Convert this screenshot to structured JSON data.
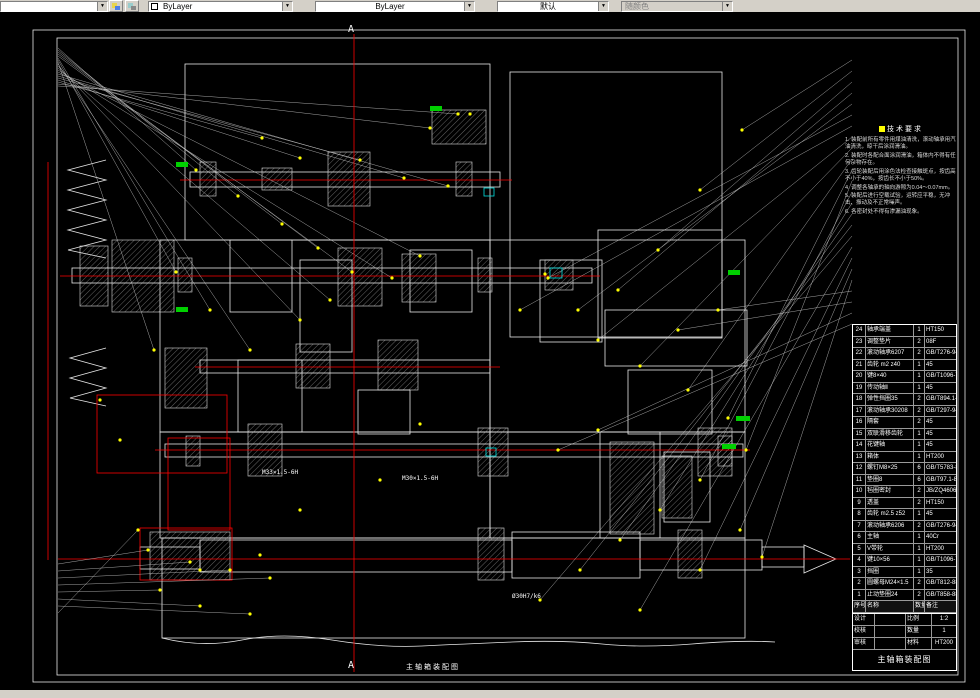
{
  "toolbar": {
    "layer_combo": {
      "value": ""
    },
    "color_control": {
      "value": "ByLayer"
    },
    "linetype_control": {
      "value": "ByLayer"
    },
    "lineweight_control": {
      "value": "默认"
    },
    "plotstyle_control": {
      "value": "随颜色"
    }
  },
  "colors": {
    "canvas_bg": "#000000",
    "line": "#ffffff",
    "centerline": "#ff0000",
    "leader_dot": "#ffff00",
    "highlight": "#00ff00"
  },
  "drawing": {
    "section_label_top": "A",
    "section_label_bottom": "A",
    "dim_labels": [
      "M33×1.5-6H",
      "M30×1.5-6H",
      "Ø30H7/k6"
    ],
    "bottom_label": "主轴箱装配图",
    "tech_requirements": {
      "title": "技术要求",
      "lines": [
        "1. 装配前所有零件用煤油清洗，滚动轴承用汽油清洗，晾干后涂润滑油。",
        "2. 装配时各配合面涂润滑油，箱体内不得有任何杂物存在。",
        "3. 齿轮装配后用涂色法检查接触斑点，按齿高不小于40%，按齿长不小于50%。",
        "4. 调整各轴承的轴向游隙为0.04～0.07mm。",
        "5. 装配后进行空载试验，运转应平稳，无冲击、振动及不正常噪声。",
        "6. 各密封处不得有渗漏油现象。"
      ]
    },
    "parts_table": {
      "header": [
        "序号",
        "名称",
        "数量",
        "备注"
      ],
      "rows": [
        {
          "no": "24",
          "name": "轴承端盖",
          "qty": "1",
          "note": "HT150"
        },
        {
          "no": "23",
          "name": "调整垫片",
          "qty": "2",
          "note": "08F"
        },
        {
          "no": "22",
          "name": "滚动轴承6207",
          "qty": "2",
          "note": "GB/T276-94"
        },
        {
          "no": "21",
          "name": "齿轮 m2 z40",
          "qty": "1",
          "note": "45"
        },
        {
          "no": "20",
          "name": "键8×40",
          "qty": "1",
          "note": "GB/T1096-79"
        },
        {
          "no": "19",
          "name": "传动轴Ⅱ",
          "qty": "1",
          "note": "45"
        },
        {
          "no": "18",
          "name": "弹性挡圈35",
          "qty": "2",
          "note": "GB/T894.1-86"
        },
        {
          "no": "17",
          "name": "滚动轴承30208",
          "qty": "2",
          "note": "GB/T297-94"
        },
        {
          "no": "16",
          "name": "隔套",
          "qty": "2",
          "note": "45"
        },
        {
          "no": "15",
          "name": "双联滑移齿轮",
          "qty": "1",
          "note": "45"
        },
        {
          "no": "14",
          "name": "花键轴",
          "qty": "1",
          "note": "45"
        },
        {
          "no": "13",
          "name": "箱体",
          "qty": "1",
          "note": "HT200"
        },
        {
          "no": "12",
          "name": "螺钉M8×25",
          "qty": "6",
          "note": "GB/T5783-86"
        },
        {
          "no": "11",
          "name": "垫圈8",
          "qty": "6",
          "note": "GB/T97.1-85"
        },
        {
          "no": "10",
          "name": "毡圈密封",
          "qty": "2",
          "note": "JB/ZQ4606"
        },
        {
          "no": "9",
          "name": "透盖",
          "qty": "2",
          "note": "HT150"
        },
        {
          "no": "8",
          "name": "齿轮 m2.5 z52",
          "qty": "1",
          "note": "45"
        },
        {
          "no": "7",
          "name": "滚动轴承6206",
          "qty": "2",
          "note": "GB/T276-94"
        },
        {
          "no": "6",
          "name": "主轴",
          "qty": "1",
          "note": "40Cr"
        },
        {
          "no": "5",
          "name": "V带轮",
          "qty": "1",
          "note": "HT200"
        },
        {
          "no": "4",
          "name": "键10×56",
          "qty": "1",
          "note": "GB/T1096-79"
        },
        {
          "no": "3",
          "name": "挡圈",
          "qty": "1",
          "note": "35"
        },
        {
          "no": "2",
          "name": "圆螺母M24×1.5",
          "qty": "2",
          "note": "GB/T812-88"
        },
        {
          "no": "1",
          "name": "止动垫圈24",
          "qty": "2",
          "note": "GB/T858-88"
        }
      ]
    },
    "title_block": {
      "rows": [
        {
          "label": "设计",
          "k": "比例",
          "v": "1:2"
        },
        {
          "label": "校核",
          "k": "数量",
          "v": "1"
        },
        {
          "label": "审核",
          "k": "材料",
          "v": "HT200"
        }
      ],
      "name": "主轴箱装配图"
    }
  }
}
